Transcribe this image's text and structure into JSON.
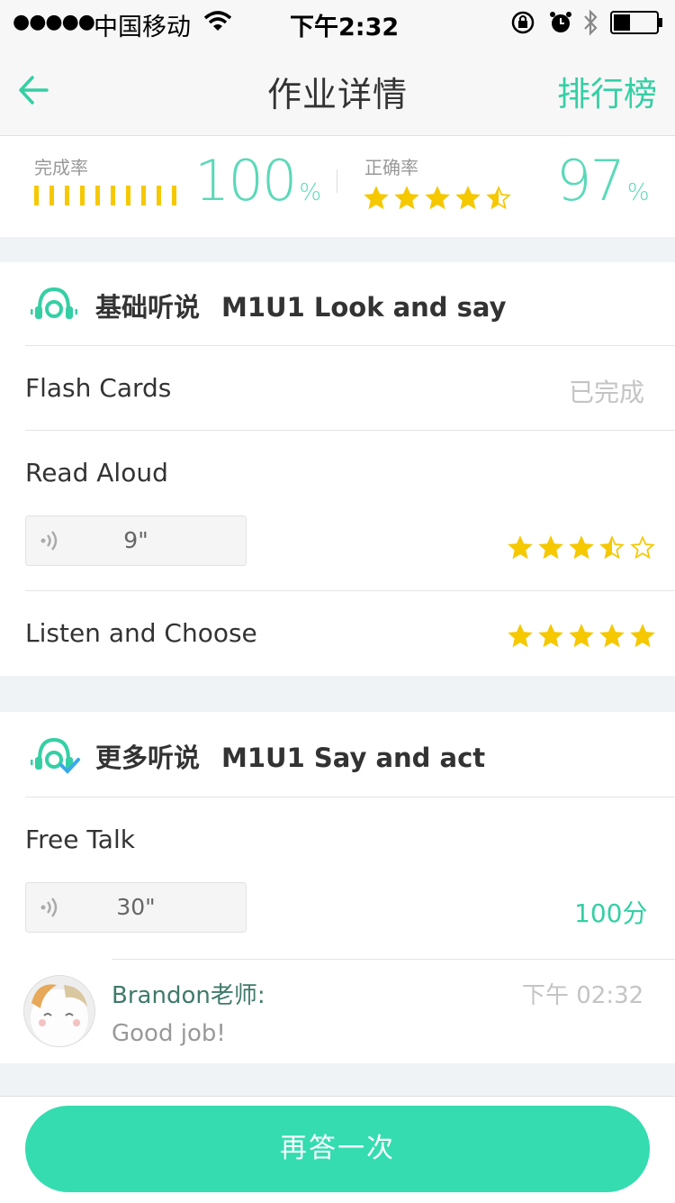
{
  "status_bar": {
    "signal": "●●●●●",
    "carrier": "中国移动",
    "time": "下午2:32"
  },
  "nav": {
    "title": "作业详情",
    "right_label": "排行榜"
  },
  "stats": {
    "completion_label": "完成率",
    "completion_value": "100",
    "completion_unit": "%",
    "accuracy_label": "正确率",
    "accuracy_value": "97",
    "accuracy_unit": "%",
    "accuracy_stars": 4.5
  },
  "sections": [
    {
      "category": "基础听说",
      "title": "M1U1 Look and say",
      "items": [
        {
          "name": "Flash Cards",
          "status": "已完成"
        },
        {
          "name": "Read Aloud",
          "audio_duration": "9\"",
          "stars": 3.5
        },
        {
          "name": "Listen and Choose",
          "stars": 5
        }
      ]
    },
    {
      "category": "更多听说",
      "title": "M1U1 Say and act",
      "items": [
        {
          "name": "Free Talk",
          "audio_duration": "30\"",
          "score": "100分"
        }
      ]
    }
  ],
  "comment": {
    "teacher": "Brandon老师:",
    "text": "Good job!",
    "time": "下午 02:32"
  },
  "footer": {
    "retry_label": "再答一次"
  },
  "colors": {
    "accent": "#35cfa4",
    "star": "#f5c800",
    "button": "#35dcb0"
  }
}
